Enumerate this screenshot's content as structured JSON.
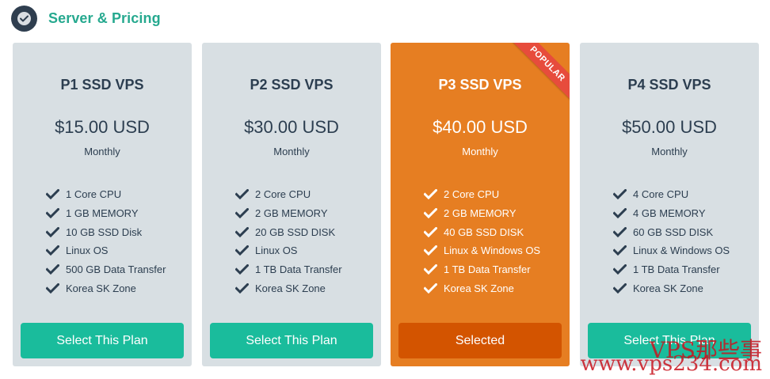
{
  "section": {
    "title": "Server & Pricing",
    "icon": "check-circle-icon"
  },
  "plans": [
    {
      "name": "P1 SSD VPS",
      "price": "$15.00 USD",
      "period": "Monthly",
      "features": [
        "1 Core CPU",
        "1 GB MEMORY",
        "10 GB SSD Disk",
        "Linux OS",
        "500 GB Data Transfer",
        "Korea SK Zone"
      ],
      "button": "Select This Plan",
      "featured": false
    },
    {
      "name": "P2 SSD VPS",
      "price": "$30.00 USD",
      "period": "Monthly",
      "features": [
        "2 Core CPU",
        "2 GB MEMORY",
        "20 GB SSD DISK",
        "Linux OS",
        "1 TB Data Transfer",
        "Korea SK Zone"
      ],
      "button": "Select This Plan",
      "featured": false
    },
    {
      "name": "P3 SSD VPS",
      "price": "$40.00 USD",
      "period": "Monthly",
      "features": [
        "2 Core CPU",
        "2 GB MEMORY",
        "40 GB SSD DISK",
        "Linux & Windows OS",
        "1 TB Data Transfer",
        "Korea SK Zone"
      ],
      "button": "Selected",
      "featured": true,
      "ribbon": "POPULAR"
    },
    {
      "name": "P4 SSD VPS",
      "price": "$50.00 USD",
      "period": "Monthly",
      "features": [
        "4 Core CPU",
        "4 GB MEMORY",
        "60 GB SSD DISK",
        "Linux & Windows OS",
        "1 TB Data Transfer",
        "Korea SK Zone"
      ],
      "button": "Select This Plan",
      "featured": false
    }
  ],
  "watermark": {
    "cn": "VPS那些事",
    "url": "www.vps234.com"
  },
  "colors": {
    "accent": "#1abc9c",
    "heading_green": "#26a98f",
    "card_bg": "#d8dfe3",
    "featured_bg": "#e67e22",
    "featured_button": "#d35400",
    "ribbon": "#e74c3c",
    "text_dark": "#2c3e50"
  }
}
